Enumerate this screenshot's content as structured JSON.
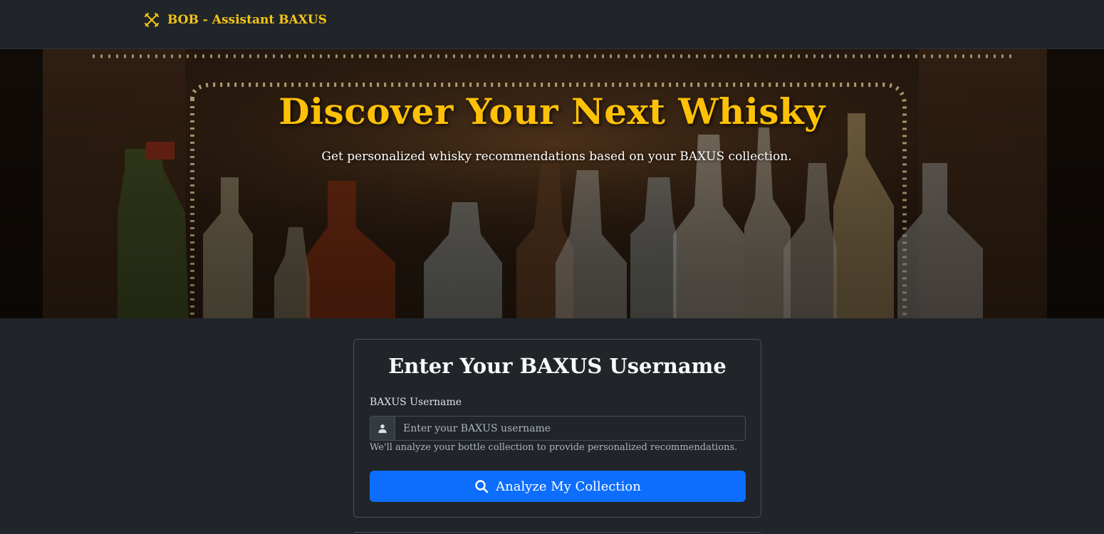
{
  "navbar": {
    "brand_label": "BOB - Assistant BAXUS",
    "brand_icon": "crossed-x-logo-icon",
    "brand_color": "#f5c518"
  },
  "hero": {
    "title": "Discover Your Next Whisky",
    "subtitle": "Get personalized whisky recommendations based on your BAXUS collection.",
    "title_color": "#ffc107"
  },
  "form": {
    "title": "Enter Your BAXUS Username",
    "username_label": "BAXUS Username",
    "username_placeholder": "Enter your BAXUS username",
    "username_value": "",
    "input_icon": "user-icon",
    "help_text": "We'll analyze your bottle collection to provide personalized recommendations.",
    "submit_label": "Analyze My Collection",
    "submit_icon": "search-icon",
    "submit_color": "#0d6efd"
  }
}
